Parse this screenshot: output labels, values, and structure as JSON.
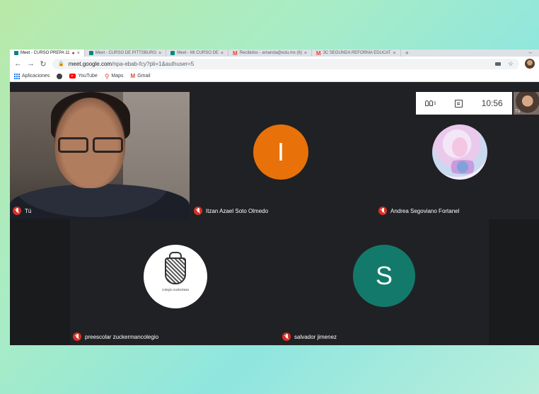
{
  "browser": {
    "tabs": [
      {
        "label": "Meet - CURSO PREPA 11",
        "active": true
      },
      {
        "label": "Meet - CURSO DE PITTSBURG",
        "active": false
      },
      {
        "label": "Meet - MI CURSO DE",
        "active": false
      },
      {
        "label": "Recibidos - amanda@edu.mx (6)",
        "active": false
      },
      {
        "label": "3C SEGUNDA REFORMA EDUCAT",
        "active": false
      }
    ],
    "url_host": "meet.google.com",
    "url_path": "/npa-ebab-fcy?pli=1&authuser=5"
  },
  "bookmarks": {
    "apps": "Aplicaciones",
    "youtube": "YouTube",
    "maps": "Maps",
    "gmail": "Gmail"
  },
  "meet": {
    "time": "10:56",
    "self_label": "Tú",
    "self_thumb_label": "Tú",
    "participants": [
      {
        "name": "Itzan Azael Soto Olmedo",
        "initial": "I",
        "color": "#e8710a"
      },
      {
        "name": "Andrea Segoviano Fortanel"
      },
      {
        "name": "preescolar zuckermancolegio"
      },
      {
        "name": "salvador jimenez",
        "initial": "S",
        "color": "#137a6b"
      }
    ],
    "seal_text": "colegio zuckerman"
  },
  "colors": {
    "meet_bg": "#202124",
    "tile_bg": "#3c4043",
    "mute_red": "#d93025"
  }
}
